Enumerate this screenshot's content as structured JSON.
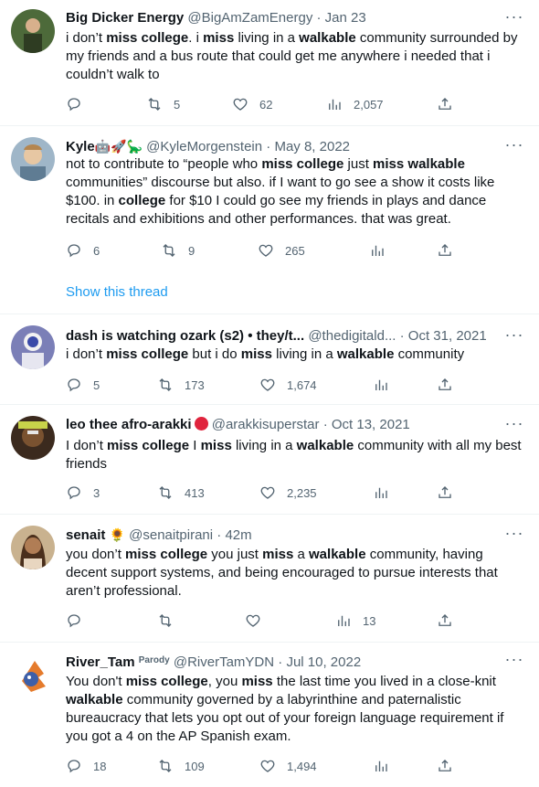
{
  "tweets": [
    {
      "name": "Big Dicker Energy",
      "handle": "@BigAmZamEnergy",
      "date": "Jan 23",
      "segments": [
        {
          "t": "i don’t "
        },
        {
          "t": "miss college",
          "b": true
        },
        {
          "t": ". i "
        },
        {
          "t": "miss",
          "b": true
        },
        {
          "t": " living in a "
        },
        {
          "t": "walkable",
          "b": true
        },
        {
          "t": " community surrounded by my friends and a bus route that could get me anywhere i needed that i couldn’t walk to"
        }
      ],
      "replies": "",
      "retweets": "5",
      "likes": "62",
      "views": "2,057"
    },
    {
      "name": "Kyle",
      "name_emoji": "🤖🚀🦕",
      "handle": "@KyleMorgenstein",
      "date": "May 8, 2022",
      "segments": [
        {
          "t": "not to contribute to “people who "
        },
        {
          "t": "miss college",
          "b": true
        },
        {
          "t": " just "
        },
        {
          "t": "miss walkable",
          "b": true
        },
        {
          "t": " communities” discourse but also. if I want to go see a show it costs like $100. in "
        },
        {
          "t": "college",
          "b": true
        },
        {
          "t": " for $10 I could go see my friends in plays and dance recitals and exhibitions and other performances. that was great."
        }
      ],
      "replies": "6",
      "retweets": "9",
      "likes": "265",
      "views": "",
      "show_thread": "Show this thread"
    },
    {
      "name": "dash is watching ozark (s2) • they/t...",
      "handle": "@thedigitald...",
      "date": "Oct 31, 2021",
      "segments": [
        {
          "t": "i don’t "
        },
        {
          "t": "miss college",
          "b": true
        },
        {
          "t": " but i do "
        },
        {
          "t": "miss",
          "b": true
        },
        {
          "t": " living in a "
        },
        {
          "t": "walkable",
          "b": true
        },
        {
          "t": " community"
        }
      ],
      "replies": "5",
      "retweets": "173",
      "likes": "1,674",
      "views": ""
    },
    {
      "name": "leo thee afro-arakki",
      "handle": "@arakkisuperstar",
      "date": "Oct 13, 2021",
      "segments": [
        {
          "t": "I don’t "
        },
        {
          "t": "miss college",
          "b": true
        },
        {
          "t": " I "
        },
        {
          "t": "miss",
          "b": true
        },
        {
          "t": " living in a "
        },
        {
          "t": "walkable",
          "b": true
        },
        {
          "t": " community with all my best friends"
        }
      ],
      "replies": "3",
      "retweets": "413",
      "likes": "2,235",
      "views": ""
    },
    {
      "name": "senait",
      "name_emoji": "🌻",
      "handle": "@senaitpirani",
      "date": "42m",
      "segments": [
        {
          "t": "you don’t "
        },
        {
          "t": "miss college",
          "b": true
        },
        {
          "t": " you just "
        },
        {
          "t": "miss",
          "b": true
        },
        {
          "t": " a "
        },
        {
          "t": "walkable",
          "b": true
        },
        {
          "t": " community, having decent support systems, and being encouraged to pursue interests that aren’t professional."
        }
      ],
      "replies": "",
      "retweets": "",
      "likes": "",
      "views": "13"
    },
    {
      "name": "River_Tam",
      "parody_label": "Parody",
      "handle": "@RiverTamYDN",
      "date": "Jul 10, 2022",
      "segments": [
        {
          "t": "You don't "
        },
        {
          "t": "miss college",
          "b": true
        },
        {
          "t": ", you "
        },
        {
          "t": "miss",
          "b": true
        },
        {
          "t": " the last time you lived in a close-knit "
        },
        {
          "t": "walkable",
          "b": true
        },
        {
          "t": " community governed by a labyrinthine and paternalistic bureaucracy that lets you opt out of your foreign language requirement if you got a 4 on the AP Spanish exam."
        }
      ],
      "replies": "18",
      "retweets": "109",
      "likes": "1,494",
      "views": ""
    }
  ],
  "dot_separator": "·",
  "more_glyph": "···",
  "colors": {
    "text": "#0f1419",
    "secondary": "#536471",
    "link": "#1d9bf0",
    "divider": "#eff3f4"
  }
}
